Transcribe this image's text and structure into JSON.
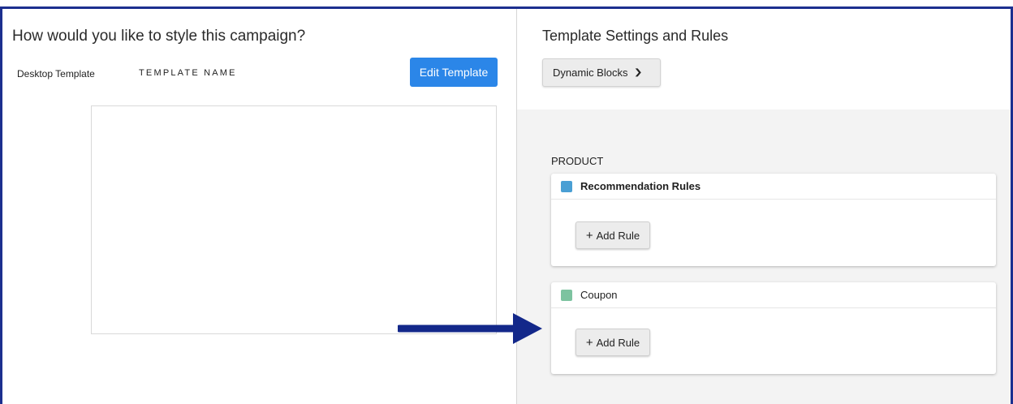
{
  "left_panel": {
    "title": "How would you like to style this campaign?",
    "desktop_label": "Desktop Template",
    "template_name": "TEMPLATE NAME",
    "edit_button": "Edit Template"
  },
  "right_panel": {
    "title": "Template Settings and Rules",
    "dropdown": {
      "label": "Dynamic Blocks",
      "icon": "chevron-down-icon"
    },
    "section_label": "PRODUCT",
    "cards": [
      {
        "title": "Recommendation Rules",
        "color": "#4a9fd4",
        "add_label": "Add Rule"
      },
      {
        "title": "Coupon",
        "color": "#7dc3a0",
        "add_label": "Add Rule"
      }
    ]
  },
  "colors": {
    "frame": "#1c2f8f",
    "primary_button": "#2b86e8",
    "arrow": "#13288a"
  }
}
